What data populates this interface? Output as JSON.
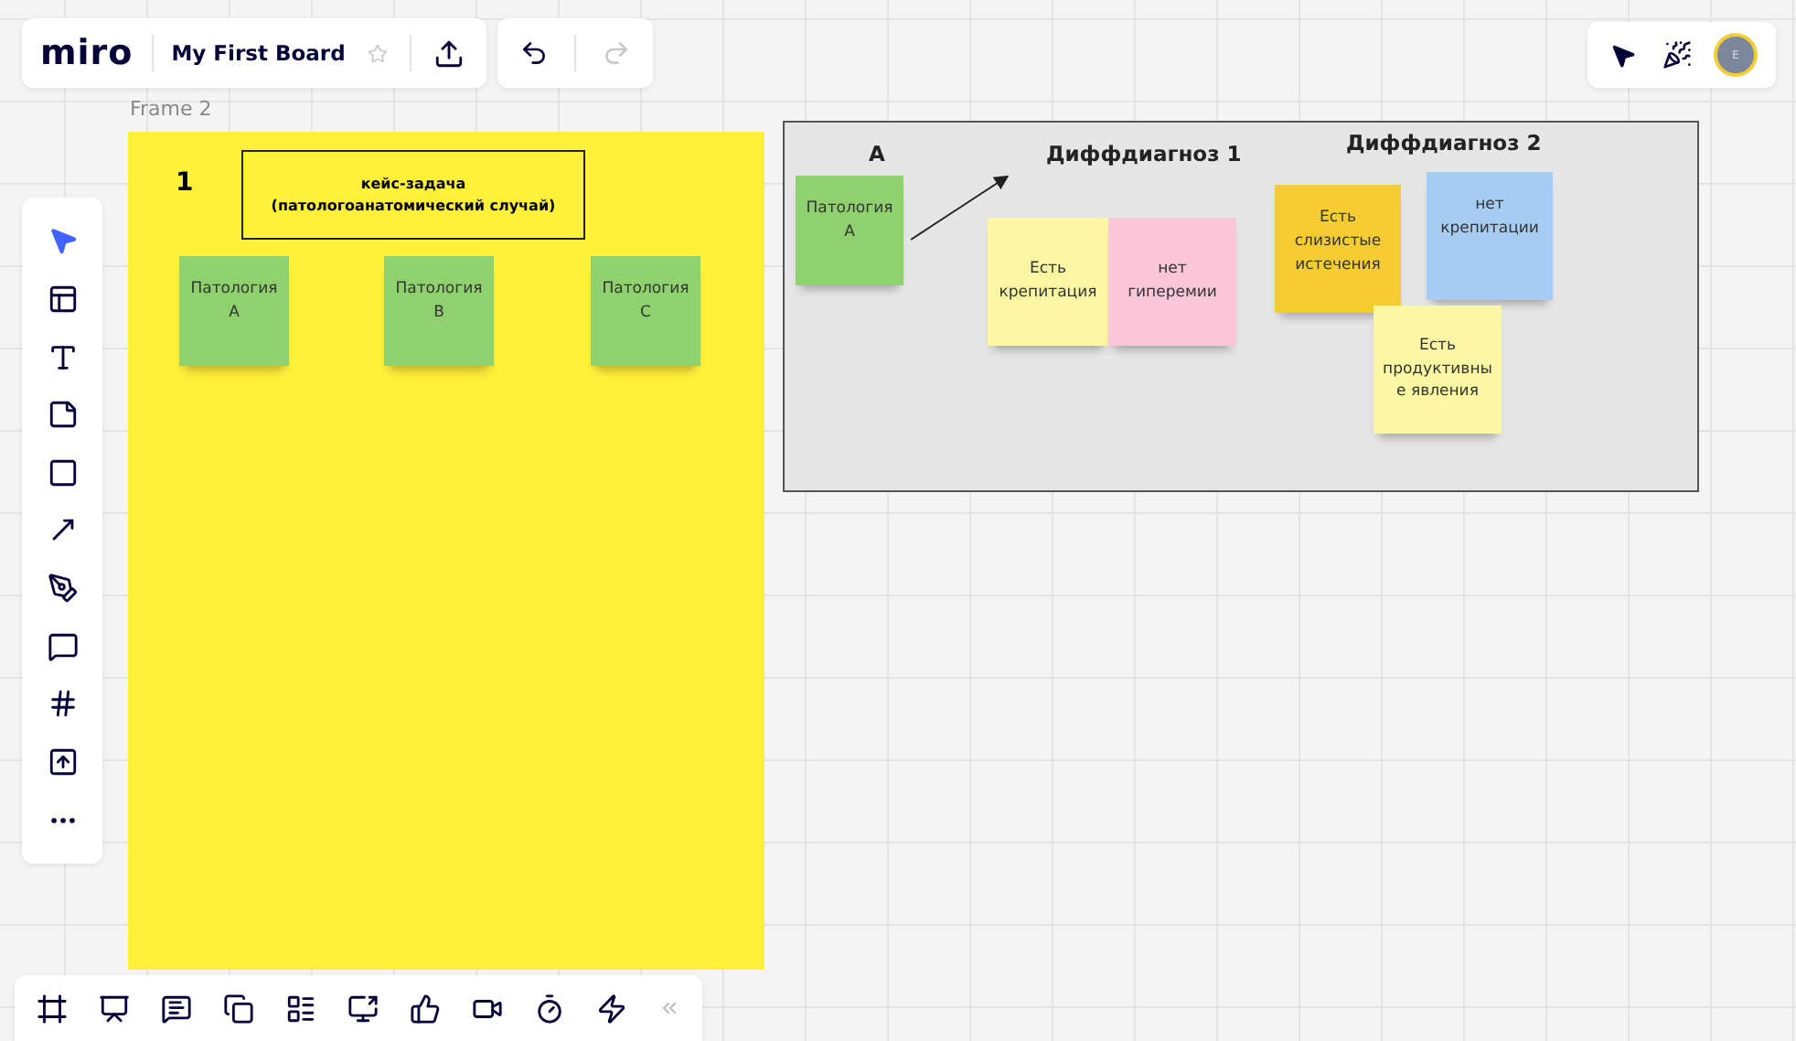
{
  "top_bar": {
    "logo": "miro",
    "board_title": "My First Board",
    "starred": false,
    "redo_disabled": true
  },
  "frame_label": "Frame 2",
  "case_frame": {
    "number": "1",
    "title": "кейс-задача\n(патологоанатомический случай)",
    "stickies": [
      {
        "text": "Патология\nA",
        "color": "#8fd16f"
      },
      {
        "text": "Патология\nB",
        "color": "#8fd16f"
      },
      {
        "text": "Патология\nC",
        "color": "#8fd16f"
      }
    ]
  },
  "diff_frame": {
    "headings": [
      "A",
      "Диффдиагноз 1",
      "Диффдиагноз 2"
    ],
    "stickies": [
      {
        "text": "Патология\nA",
        "color": "#8fd16f"
      },
      {
        "text": "Есть\nкрепитация",
        "color": "#fbf6a4"
      },
      {
        "text": "нет\nгиперемии",
        "color": "#fbc6d8"
      },
      {
        "text": "Есть\nслизистые\nистечения",
        "color": "#f5cd33"
      },
      {
        "text": "нет\nкрепитации",
        "color": "#a7ccf2"
      },
      {
        "text": "Есть\nпродуктивны\nе явления",
        "color": "#fbf6a4"
      }
    ]
  },
  "left_tools": [
    {
      "kind": "select",
      "selected": true
    },
    {
      "kind": "templates",
      "selected": false
    },
    {
      "kind": "text",
      "selected": false
    },
    {
      "kind": "sticky",
      "selected": false
    },
    {
      "kind": "shape",
      "selected": false
    },
    {
      "kind": "connector",
      "selected": false
    },
    {
      "kind": "pen",
      "selected": false
    },
    {
      "kind": "comment",
      "selected": false
    },
    {
      "kind": "frame",
      "selected": false
    },
    {
      "kind": "upload",
      "selected": false
    },
    {
      "kind": "more",
      "selected": false
    }
  ],
  "user": {
    "initial": "E"
  }
}
